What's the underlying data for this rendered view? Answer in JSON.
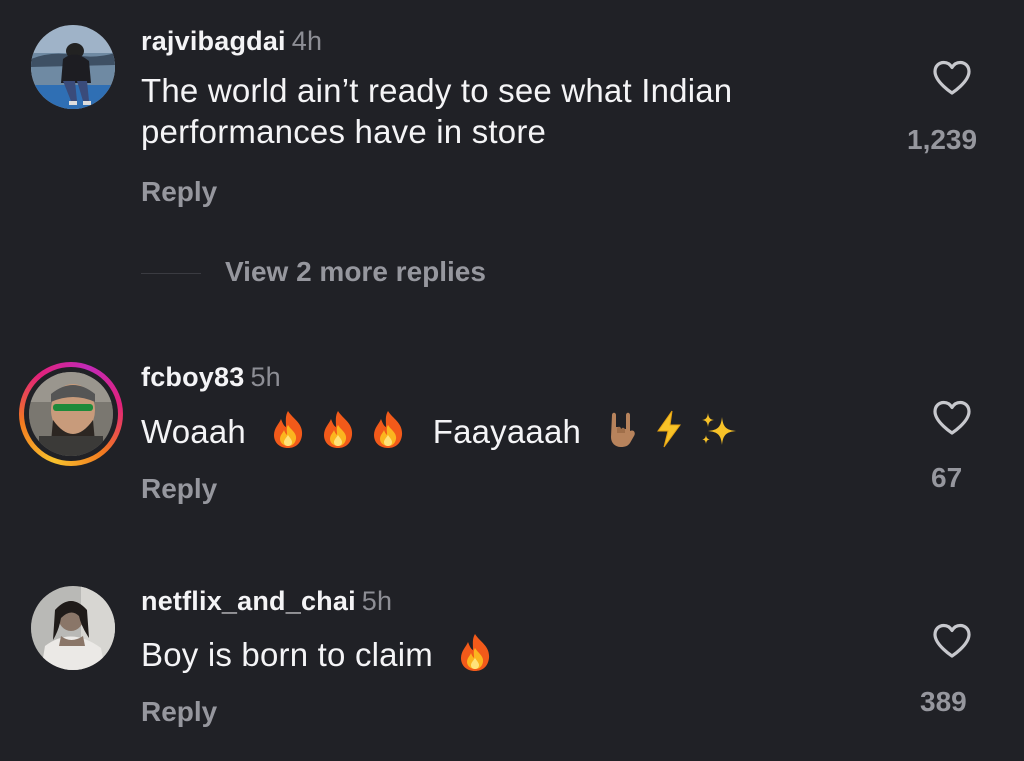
{
  "comments": [
    {
      "username": "rajvibagdai",
      "time": "4h",
      "text": "The world ain’t ready to see what Indian performances have in store",
      "reply_label": "Reply",
      "likes": "1,239",
      "view_replies": "View 2 more replies"
    },
    {
      "username": "fcboy83",
      "time": "5h",
      "text_start": "Woaah",
      "text_mid": "Faayaaah",
      "reply_label": "Reply",
      "likes": "67"
    },
    {
      "username": "netflix_and_chai",
      "time": "5h",
      "text": "Boy is born to claim",
      "reply_label": "Reply",
      "likes": "389"
    }
  ],
  "colors": {
    "background": "#202126",
    "primary_text": "#f4f4f6",
    "secondary_text": "#96979e",
    "story_ring": [
      "#f8c22d",
      "#f27a20",
      "#e2227a",
      "#c22ab8"
    ]
  },
  "icons": [
    "heart-outline-icon",
    "fire-emoji",
    "rock-on-hand-emoji",
    "lightning-emoji",
    "sparkles-emoji"
  ]
}
